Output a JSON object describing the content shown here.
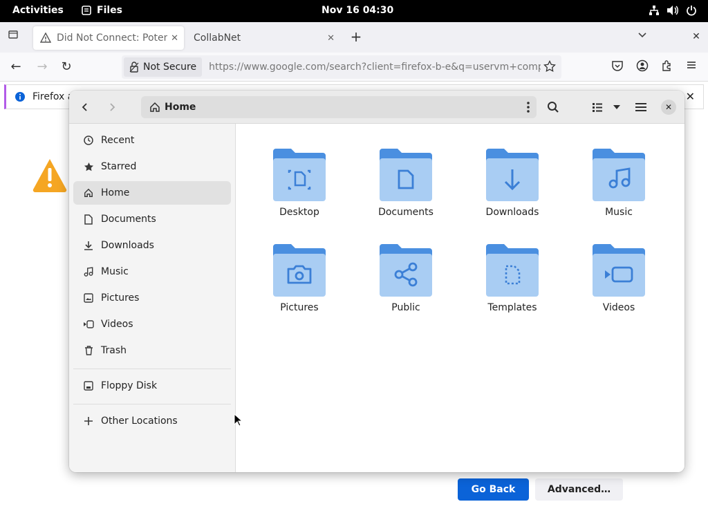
{
  "topbar": {
    "activities": "Activities",
    "app_name": "Files",
    "clock": "Nov 16  04:30"
  },
  "browser": {
    "tabs": [
      {
        "label": "Did Not Connect: Potenti",
        "active": true
      },
      {
        "label": "CollabNet",
        "active": false
      }
    ],
    "security_label": "Not Secure",
    "url": "https://www.google.com/search?client=firefox-b-e&q=uservm+comp",
    "notification_text": "Firefox a",
    "go_back_label": "Go Back",
    "advanced_label": "Advanced…"
  },
  "files": {
    "location": "Home",
    "sidebar": [
      {
        "label": "Recent",
        "icon": "clock-icon"
      },
      {
        "label": "Starred",
        "icon": "star-icon"
      },
      {
        "label": "Home",
        "icon": "home-icon",
        "active": true
      },
      {
        "label": "Documents",
        "icon": "document-icon"
      },
      {
        "label": "Downloads",
        "icon": "download-icon"
      },
      {
        "label": "Music",
        "icon": "music-icon"
      },
      {
        "label": "Pictures",
        "icon": "picture-icon"
      },
      {
        "label": "Videos",
        "icon": "video-icon"
      },
      {
        "label": "Trash",
        "icon": "trash-icon"
      },
      {
        "label": "Floppy Disk",
        "icon": "floppy-icon"
      },
      {
        "label": "Other Locations",
        "icon": "plus-icon"
      }
    ],
    "folders": [
      {
        "label": "Desktop",
        "icon": "desktop-folder-icon"
      },
      {
        "label": "Documents",
        "icon": "documents-folder-icon"
      },
      {
        "label": "Downloads",
        "icon": "downloads-folder-icon"
      },
      {
        "label": "Music",
        "icon": "music-folder-icon"
      },
      {
        "label": "Pictures",
        "icon": "pictures-folder-icon"
      },
      {
        "label": "Public",
        "icon": "public-folder-icon"
      },
      {
        "label": "Templates",
        "icon": "templates-folder-icon"
      },
      {
        "label": "Videos",
        "icon": "videos-folder-icon"
      }
    ]
  },
  "colors": {
    "folder_back": "#4a8fe0",
    "folder_front": "#a9cdf3",
    "folder_glyph": "#3b7fd6",
    "accent_button": "#0b63d8",
    "warning": "#f5a623"
  }
}
